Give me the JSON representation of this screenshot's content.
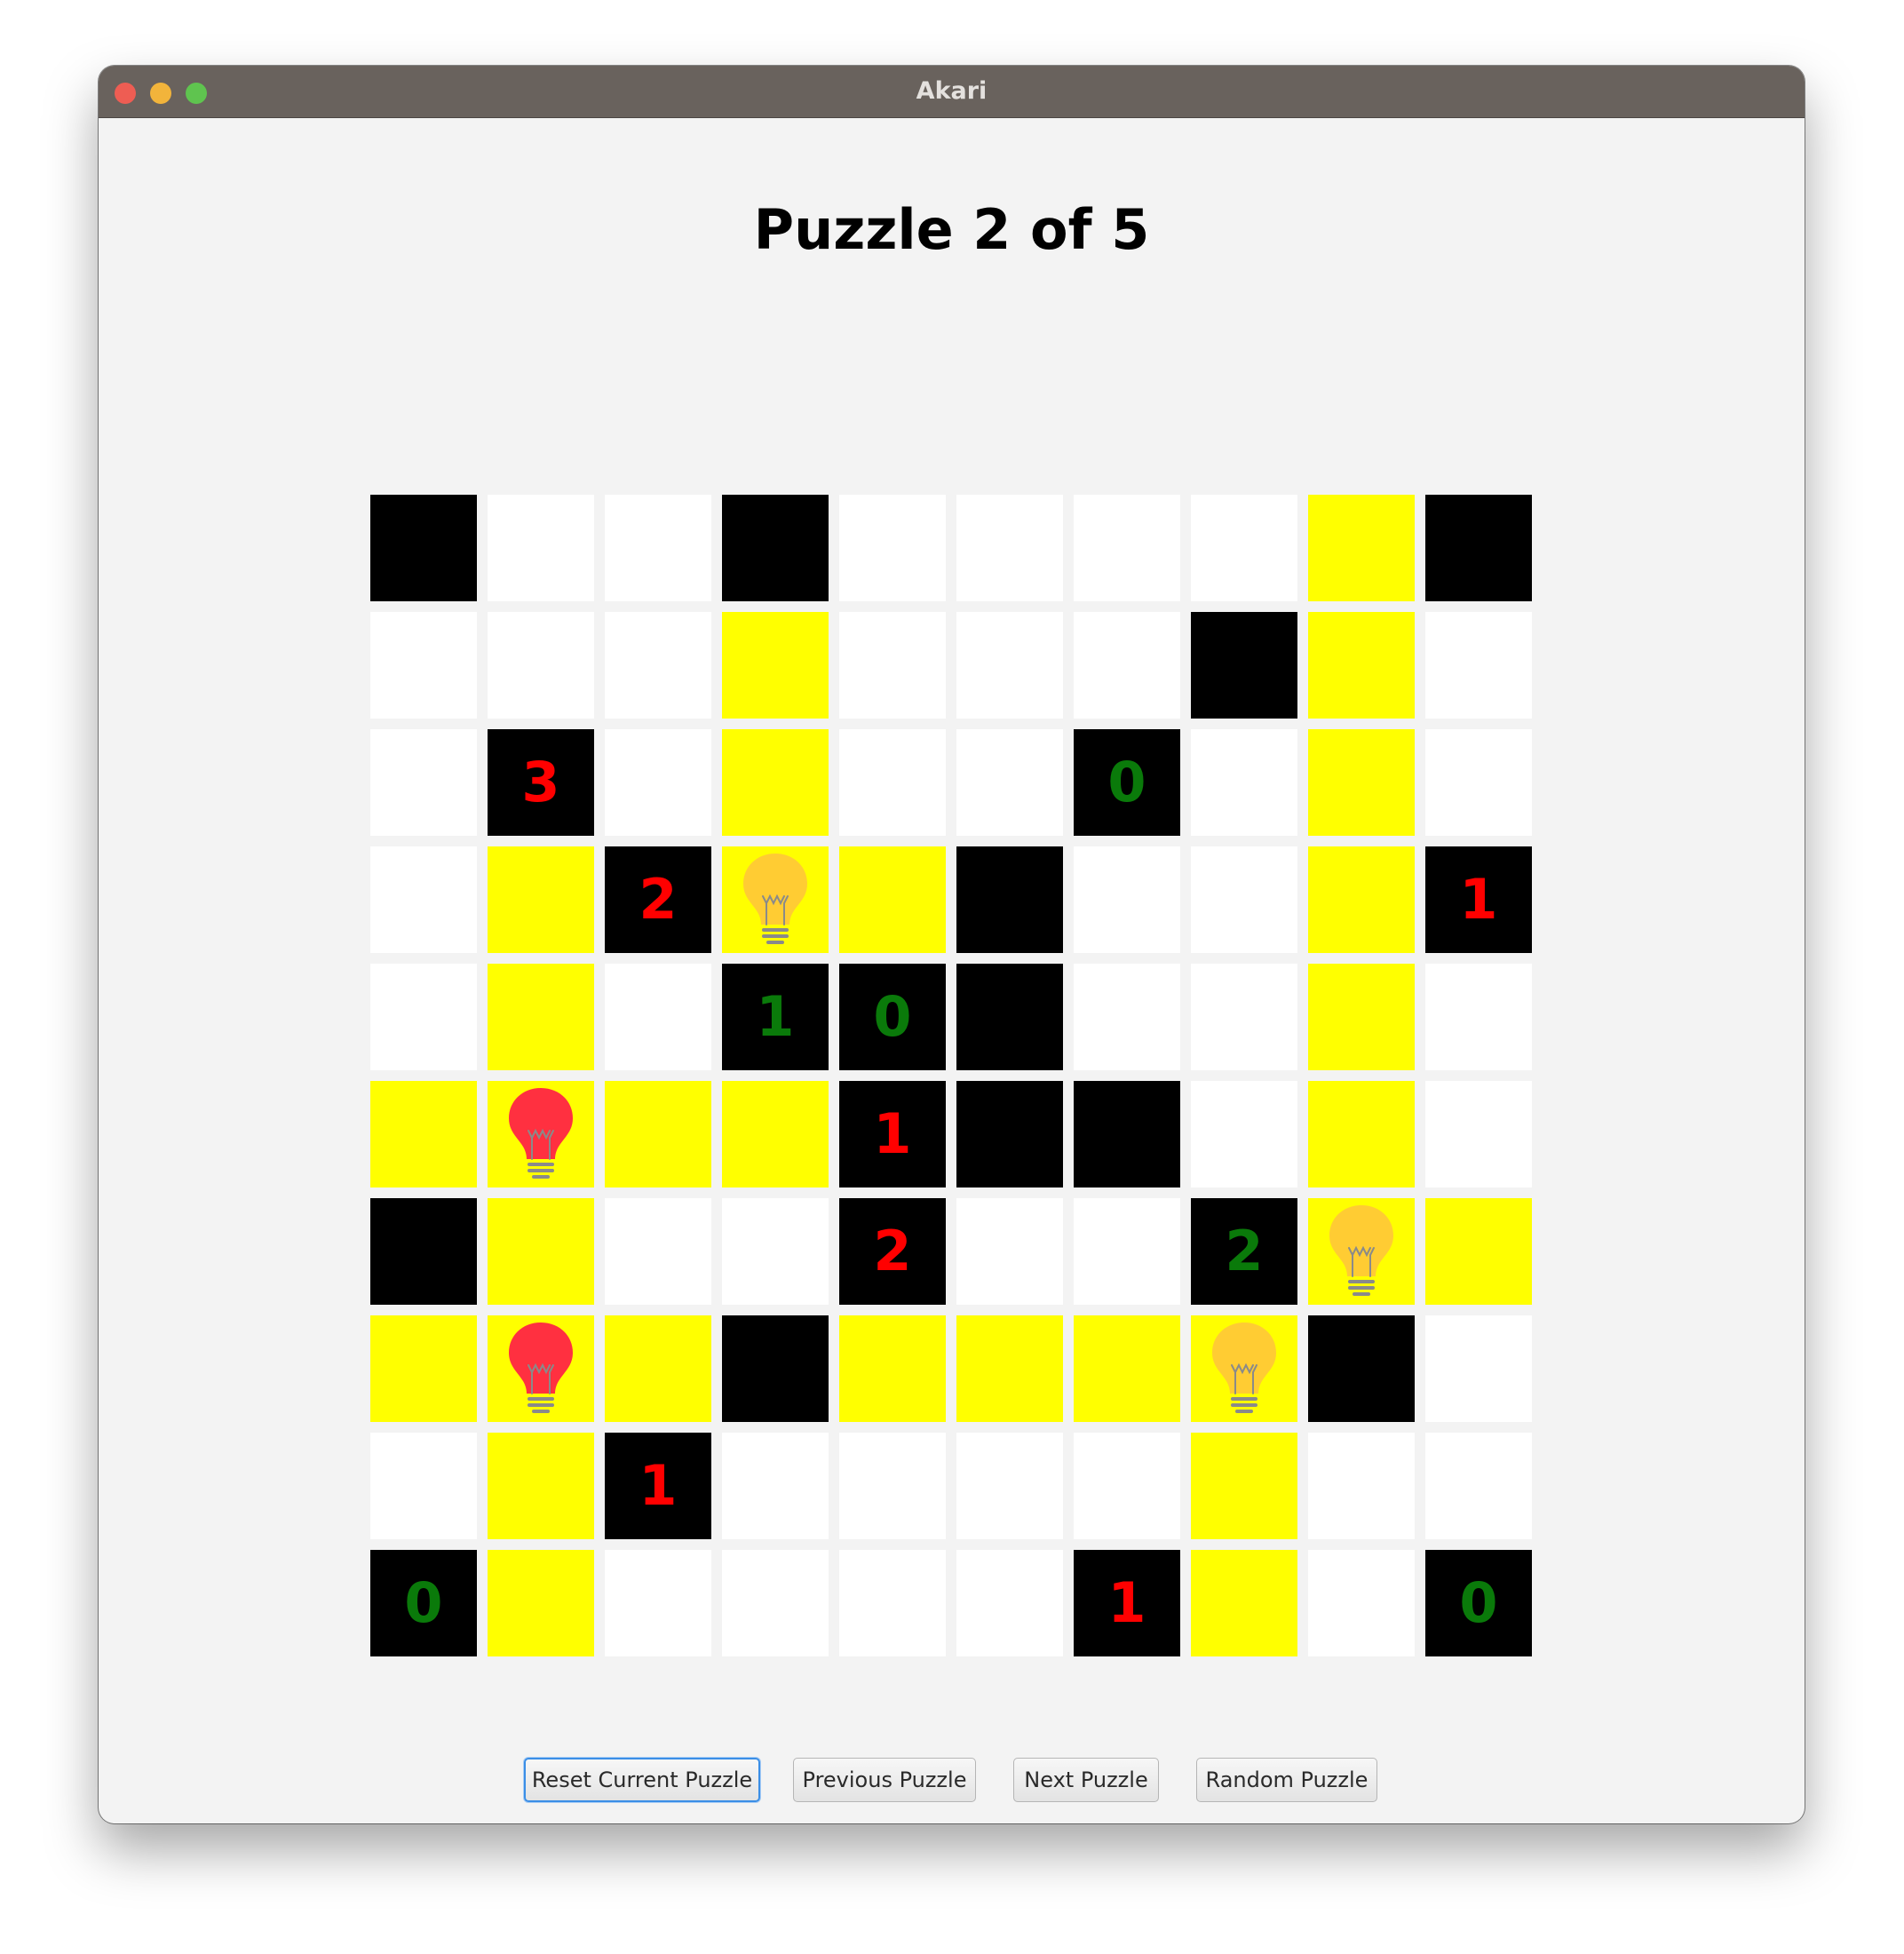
{
  "window": {
    "title": "Akari"
  },
  "header": {
    "title": "Puzzle 2 of 5"
  },
  "board": {
    "rows": 10,
    "cols": 10,
    "colors": {
      "wall": "#000000",
      "corridor": "#ffffff",
      "lit": "#ffff00",
      "clue_satisfied": "#0a7a0a",
      "clue_unsatisfied": "#ff0000",
      "lamp_ok": "#ffcc33",
      "lamp_conflict": "#ff3040"
    },
    "grid": [
      [
        "W",
        "C",
        "C",
        "W",
        "C",
        "C",
        "C",
        "C",
        "L",
        "W"
      ],
      [
        "C",
        "C",
        "C",
        "L",
        "C",
        "C",
        "C",
        "W",
        "L",
        "C"
      ],
      [
        "C",
        "W3r",
        "C",
        "L",
        "C",
        "C",
        "W0g",
        "C",
        "L",
        "C"
      ],
      [
        "C",
        "L",
        "W2r",
        "B",
        "L",
        "W",
        "C",
        "C",
        "L",
        "W1r"
      ],
      [
        "C",
        "L",
        "C",
        "W1g",
        "W0g",
        "W",
        "C",
        "C",
        "L",
        "C"
      ],
      [
        "L",
        "X",
        "L",
        "L",
        "W1r",
        "W",
        "W",
        "C",
        "L",
        "C"
      ],
      [
        "W",
        "L",
        "C",
        "C",
        "W2r",
        "C",
        "C",
        "W2g",
        "B",
        "L"
      ],
      [
        "L",
        "X",
        "L",
        "W",
        "L",
        "L",
        "L",
        "B",
        "W",
        "C"
      ],
      [
        "C",
        "L",
        "W1r",
        "C",
        "C",
        "C",
        "C",
        "L",
        "C",
        "C"
      ],
      [
        "W0g",
        "L",
        "C",
        "C",
        "C",
        "C",
        "W1r",
        "L",
        "C",
        "W0g"
      ]
    ],
    "legend": {
      "W": "wall",
      "C": "corridor",
      "L": "lit-corridor",
      "B": "lamp (valid)",
      "X": "lamp (conflict)",
      "g": "clue satisfied",
      "r": "clue unsatisfied"
    }
  },
  "controls": {
    "reset_label": "Reset Current Puzzle",
    "previous_label": "Previous Puzzle",
    "next_label": "Next Puzzle",
    "random_label": "Random Puzzle"
  }
}
